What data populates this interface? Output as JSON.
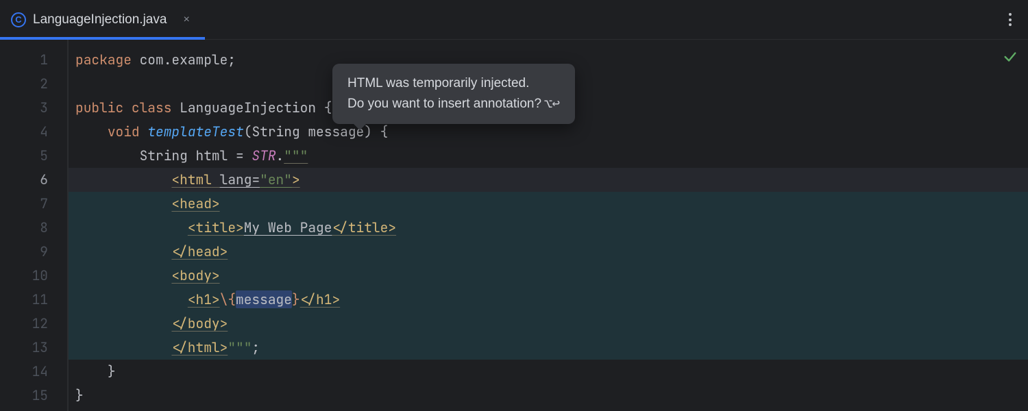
{
  "tab": {
    "icon_letter": "C",
    "label": "LanguageInjection.java",
    "close_glyph": "×"
  },
  "gutter": {
    "lines": [
      "1",
      "2",
      "3",
      "4",
      "5",
      "6",
      "7",
      "8",
      "9",
      "10",
      "11",
      "12",
      "13",
      "14",
      "15"
    ],
    "current_line": "6"
  },
  "popup": {
    "line1": "HTML was temporarily injected.",
    "line2": "Do you want to insert annotation?",
    "shortcut": "⌥↩"
  },
  "code": {
    "l1_kw": "package",
    "l1_rest": " com.example;",
    "l3_kw1": "public",
    "l3_kw2": "class",
    "l3_name": " LanguageInjection {",
    "l4_kw": "void",
    "l4_fn": "templateTest",
    "l4_sig_open": "(",
    "l4_paramtype": "String",
    "l4_paramname": " message",
    "l4_sig_close": ") {",
    "l5_type": "String",
    "l5_var": " html ",
    "l5_eq": "= ",
    "l5_str": "STR",
    "l5_dot": ".",
    "l5_q": "\"\"\"",
    "l6_open": "<html",
    "l6_sp": " ",
    "l6_attr": "lang",
    "l6_eq": "=",
    "l6_val": "\"en\"",
    "l6_gt": ">",
    "l7": "<head>",
    "l8_open": "<title>",
    "l8_txt": "My Web Page",
    "l8_close": "</title>",
    "l9": "</head>",
    "l10": "<body>",
    "l11_open": "<h1>",
    "l11_esc": "\\{",
    "l11_var": "message",
    "l11_cb": "}",
    "l11_close": "</h1>",
    "l12": "</body>",
    "l13_open": "</html>",
    "l13_q": "\"\"\"",
    "l13_semi": ";",
    "l14": "}",
    "l15": "}"
  }
}
